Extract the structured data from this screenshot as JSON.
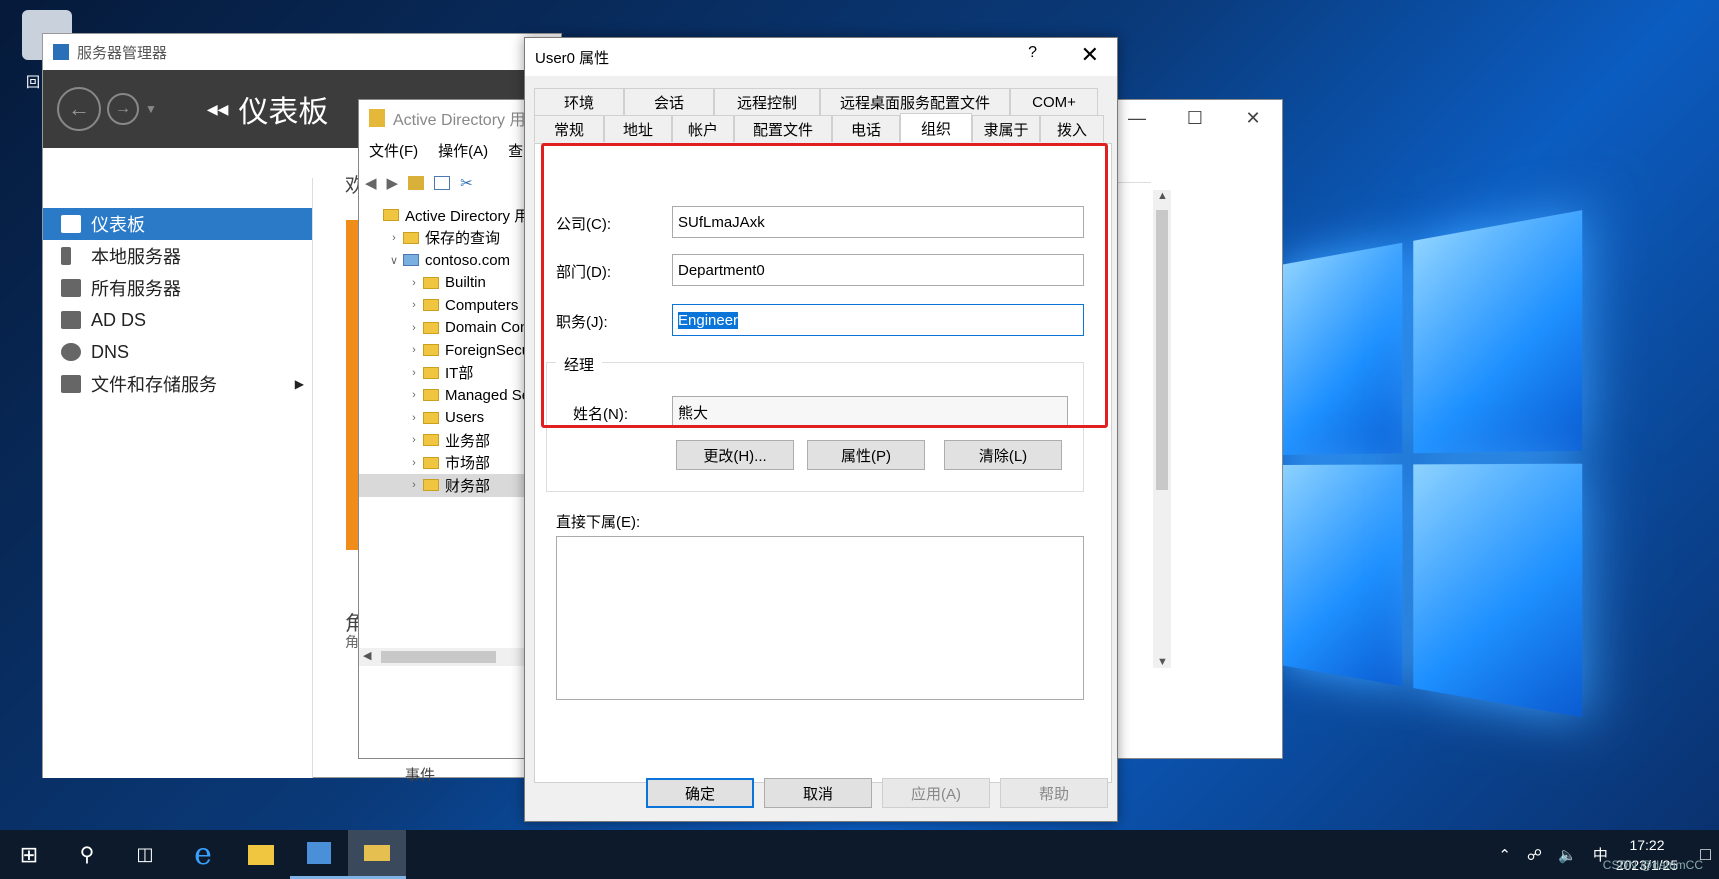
{
  "desktop": {
    "recycle_label": "回"
  },
  "server_manager": {
    "title": "服务器管理器",
    "header_title": "仪表板",
    "nav": [
      {
        "label": "仪表板",
        "selected": true
      },
      {
        "label": "本地服务器"
      },
      {
        "label": "所有服务器"
      },
      {
        "label": "AD DS"
      },
      {
        "label": "DNS"
      },
      {
        "label": "文件和存储服务"
      }
    ],
    "partial_texts": [
      "欢",
      "角",
      "角",
      "事件"
    ]
  },
  "ad_window": {
    "title": "Active Directory 用",
    "menu": [
      "文件(F)",
      "操作(A)",
      "查"
    ],
    "tree": [
      {
        "label": "Active Directory 用户",
        "indent": 0
      },
      {
        "label": "保存的查询",
        "indent": 1
      },
      {
        "label": "contoso.com",
        "indent": 1
      },
      {
        "label": "Builtin",
        "indent": 2
      },
      {
        "label": "Computers",
        "indent": 2
      },
      {
        "label": "Domain Con",
        "indent": 2
      },
      {
        "label": "ForeignSecu",
        "indent": 2
      },
      {
        "label": "IT部",
        "indent": 2
      },
      {
        "label": "Managed Se",
        "indent": 2
      },
      {
        "label": "Users",
        "indent": 2
      },
      {
        "label": "业务部",
        "indent": 2
      },
      {
        "label": "市场部",
        "indent": 2
      },
      {
        "label": "财务部",
        "indent": 2
      }
    ]
  },
  "dialog": {
    "title": "User0 属性",
    "help_glyph": "?",
    "tabs_top": [
      "环境",
      "会话",
      "远程控制",
      "远程桌面服务配置文件",
      "COM+"
    ],
    "tabs_bottom": [
      "常规",
      "地址",
      "帐户",
      "配置文件",
      "电话",
      "组织",
      "隶属于",
      "拨入"
    ],
    "selected_tab": "组织",
    "company_label": "公司(C):",
    "company_value": "SUfLmaJAxk",
    "department_label": "部门(D):",
    "department_value": "Department0",
    "title_label": "职务(J):",
    "title_value": "Engineer",
    "manager_group": "经理",
    "name_label": "姓名(N):",
    "name_value": "熊大",
    "change_btn": "更改(H)...",
    "properties_btn": "属性(P)",
    "clear_btn": "清除(L)",
    "direct_reports_label": "直接下属(E):",
    "ok_btn": "确定",
    "cancel_btn": "取消",
    "apply_btn": "应用(A)",
    "help_btn": "帮助"
  },
  "taskbar": {
    "ime": "中",
    "time": "17:22",
    "date": "2023/1/25",
    "watermark": "CSDN @datumCC"
  }
}
